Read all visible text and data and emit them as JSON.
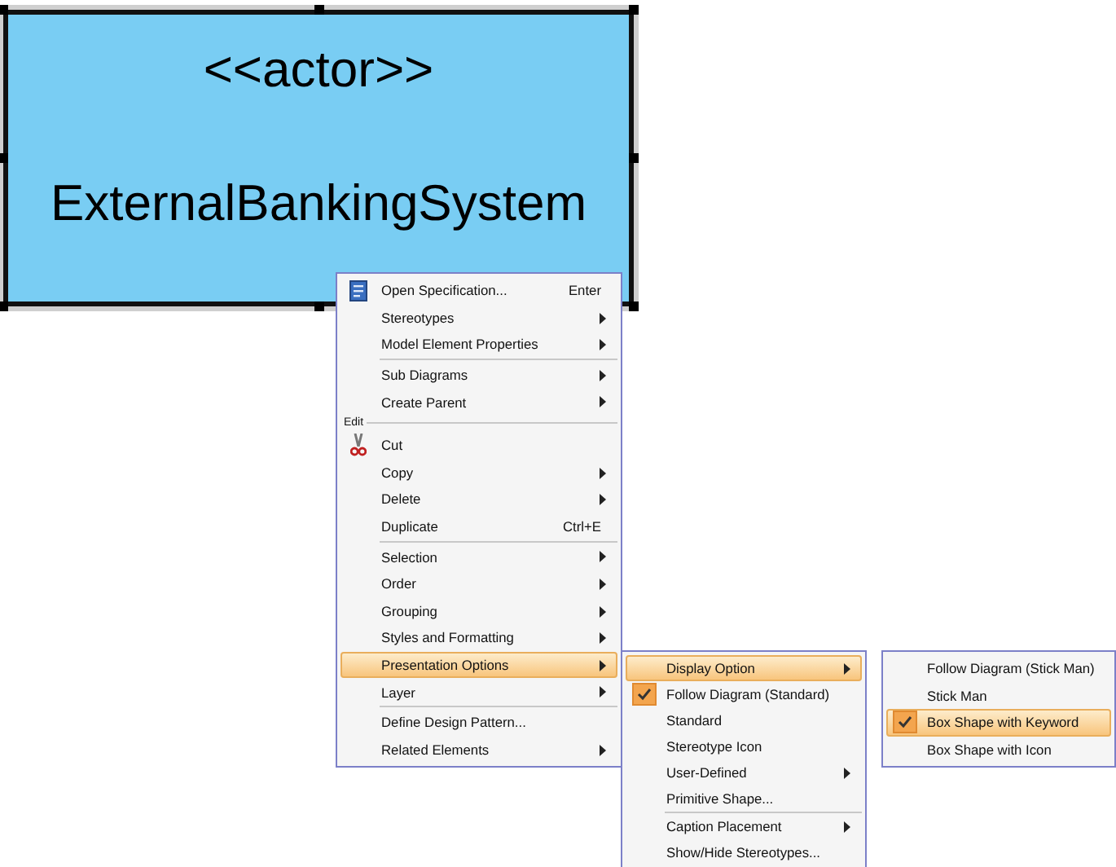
{
  "shape": {
    "stereotype": "<<actor>>",
    "name": "ExternalBankingSystem",
    "selected": true
  },
  "context_menu": {
    "groups": [
      {
        "items": [
          {
            "label": "Open Specification...",
            "shortcut": "Enter",
            "kind": "document",
            "submenu": false,
            "selected": false
          },
          {
            "label": "Stereotypes",
            "submenu": true,
            "selected": false
          },
          {
            "label": "Model Element Properties",
            "submenu": true,
            "selected": false
          }
        ]
      },
      {
        "items": [
          {
            "label": "Sub Diagrams",
            "submenu": true,
            "selected": false
          },
          {
            "label": "Create Parent",
            "submenu": true,
            "selected": false
          }
        ]
      },
      {
        "header": "Edit",
        "items": [
          {
            "label": "Cut",
            "kind": "scissors",
            "submenu": false,
            "selected": false
          },
          {
            "label": "Copy",
            "submenu": true,
            "selected": false
          },
          {
            "label": "Delete",
            "submenu": true,
            "selected": false
          },
          {
            "label": "Duplicate",
            "shortcut": "Ctrl+E",
            "submenu": false,
            "selected": false
          }
        ]
      },
      {
        "items": [
          {
            "label": "Selection",
            "submenu": true,
            "selected": false
          },
          {
            "label": "Order",
            "submenu": true,
            "selected": false
          },
          {
            "label": "Grouping",
            "submenu": true,
            "selected": false
          },
          {
            "label": "Styles and Formatting",
            "submenu": true,
            "selected": false
          },
          {
            "label": "Presentation Options",
            "submenu": true,
            "selected": true
          },
          {
            "label": "Layer",
            "submenu": true,
            "selected": false
          }
        ]
      },
      {
        "items": [
          {
            "label": "Define Design Pattern...",
            "submenu": false,
            "selected": false
          },
          {
            "label": "Related Elements",
            "submenu": true,
            "selected": false
          }
        ]
      }
    ]
  },
  "presentation_submenu": {
    "groups": [
      {
        "items": [
          {
            "label": "Display Option",
            "submenu": true,
            "selected": true,
            "checked": false
          },
          {
            "label": "Follow Diagram (Standard)",
            "submenu": false,
            "selected": false,
            "checked": true
          },
          {
            "label": "Standard",
            "submenu": false,
            "selected": false,
            "checked": false
          },
          {
            "label": "Stereotype Icon",
            "submenu": false,
            "selected": false,
            "checked": false
          },
          {
            "label": "User-Defined",
            "submenu": true,
            "selected": false,
            "checked": false
          },
          {
            "label": "Primitive Shape...",
            "submenu": false,
            "selected": false,
            "checked": false
          }
        ]
      },
      {
        "items": [
          {
            "label": "Caption Placement",
            "submenu": true,
            "selected": false,
            "checked": false
          },
          {
            "label": "Show/Hide Stereotypes...",
            "submenu": false,
            "selected": false,
            "checked": false
          }
        ]
      }
    ]
  },
  "display_submenu": {
    "groups": [
      {
        "items": [
          {
            "label": "Follow Diagram (Stick Man)",
            "submenu": false,
            "selected": false,
            "checked": false
          },
          {
            "label": "Stick Man",
            "submenu": false,
            "selected": false,
            "checked": false
          },
          {
            "label": "Box Shape with Keyword",
            "submenu": false,
            "selected": true,
            "checked": true
          },
          {
            "label": "Box Shape with Icon",
            "submenu": false,
            "selected": false,
            "checked": false
          }
        ]
      }
    ]
  }
}
